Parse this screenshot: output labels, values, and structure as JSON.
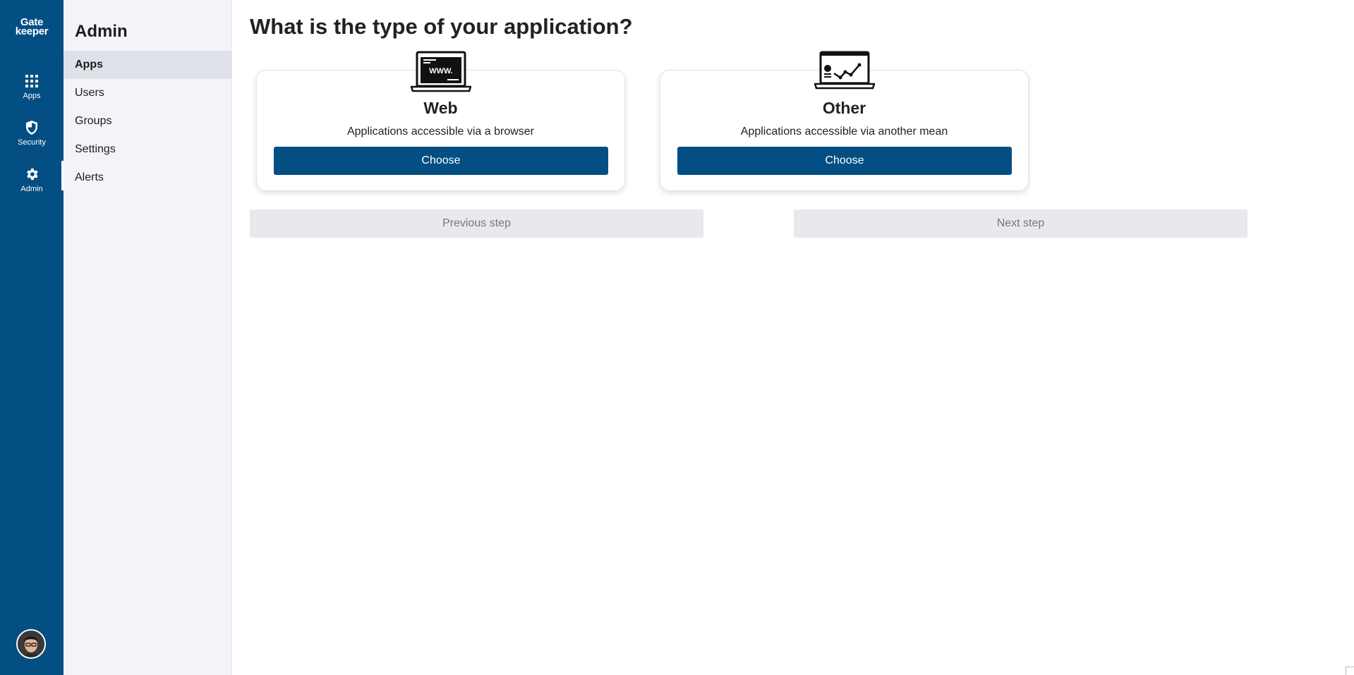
{
  "brand": {
    "line1": "Gate",
    "line2": "keeper"
  },
  "rail": {
    "items": [
      {
        "label": "Apps",
        "icon": "grid-icon"
      },
      {
        "label": "Security",
        "icon": "shield-icon"
      },
      {
        "label": "Admin",
        "icon": "gear-icon",
        "active": true
      }
    ],
    "avatar_icon": "user-avatar"
  },
  "subnav": {
    "title": "Admin",
    "items": [
      {
        "label": "Apps",
        "active": true
      },
      {
        "label": "Users"
      },
      {
        "label": "Groups"
      },
      {
        "label": "Settings"
      },
      {
        "label": "Alerts"
      }
    ]
  },
  "main": {
    "title": "What is the type of your application?",
    "cards": [
      {
        "title": "Web",
        "description": "Applications accessible via a browser",
        "button": "Choose",
        "illus_text": "WWW.",
        "icon": "laptop-www-icon"
      },
      {
        "title": "Other",
        "description": "Applications accessible via another mean",
        "button": "Choose",
        "icon": "laptop-chart-icon"
      }
    ],
    "previous_step": "Previous step",
    "next_step": "Next step"
  },
  "colors": {
    "primary": "#034f84",
    "subnav_bg": "#f3f4f8",
    "active_item_bg": "#dfe1e8",
    "disabled_btn_bg": "#e8e9ed"
  }
}
